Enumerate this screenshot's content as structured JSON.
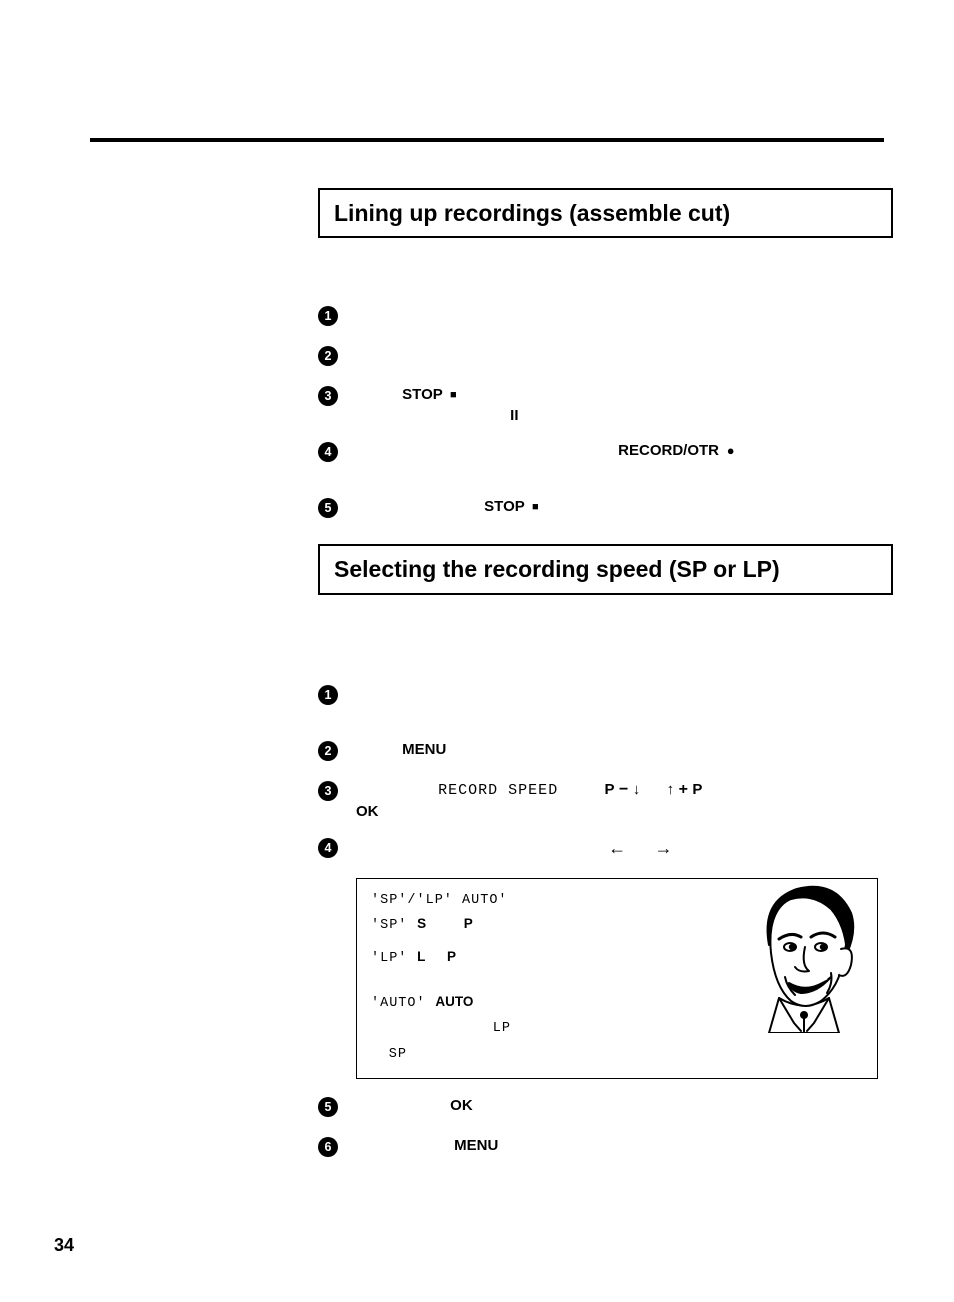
{
  "page_number": "34",
  "section1": {
    "title": "Lining up recordings (assemble cut)"
  },
  "section2": {
    "title": "Selecting the recording speed (SP or LP)"
  },
  "steps_a": {
    "s3_stop": "STOP",
    "s3_pause": "II",
    "s4_rec": "RECORD/OTR",
    "s5_stop": "STOP"
  },
  "steps_b": {
    "s2_menu": "MENU",
    "s3_record_speed": "RECORD SPEED",
    "s3_p_left": "P",
    "s3_p_right": "P",
    "s3_ok": "OK",
    "s5_ok": "OK",
    "s6_menu": "MENU"
  },
  "infobox": {
    "l1_a": "'SP'/'LP' AUTO'",
    "l2_a": "'SP'",
    "l2_b": "S",
    "l2_c": "P",
    "l3_a": "'LP'",
    "l3_b": "L",
    "l3_c": "P",
    "l4_a": "'AUTO'",
    "l4_b": "AUTO",
    "l5_a": "LP",
    "l6_a": "SP"
  }
}
